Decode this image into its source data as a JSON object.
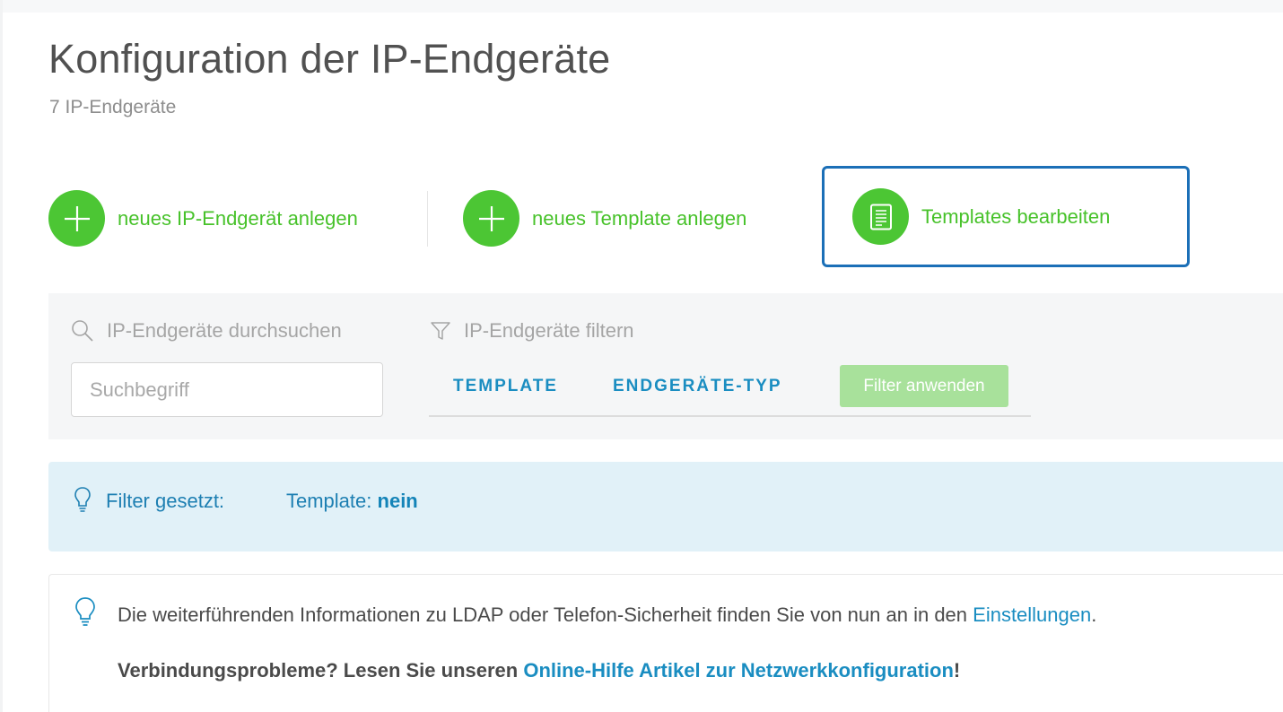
{
  "page": {
    "title": "Konfiguration der IP-Endgeräte",
    "subtitle": "7 IP-Endgeräte"
  },
  "actions": {
    "new_device": {
      "label": "neues IP-Endgerät anlegen",
      "icon": "plus-icon"
    },
    "new_template": {
      "label": "neues Template anlegen",
      "icon": "plus-icon"
    },
    "edit_templates": {
      "label": "Templates bearbeiten",
      "icon": "document-icon"
    }
  },
  "search": {
    "label": "IP-Endgeräte durchsuchen",
    "placeholder": "Suchbegriff",
    "value": "",
    "icon": "search-icon"
  },
  "filter": {
    "label": "IP-Endgeräte filtern",
    "icon": "funnel-icon",
    "tabs": [
      "TEMPLATE",
      "ENDGERÄTE-TYP"
    ],
    "apply_label": "Filter anwenden"
  },
  "active_filter": {
    "label": "Filter gesetzt:",
    "key": "Template:",
    "value": "nein",
    "icon": "lightbulb-icon"
  },
  "info": {
    "icon": "lightbulb-icon",
    "line1_text": "Die weiterführenden Informationen zu LDAP oder Telefon-Sicherheit finden Sie von nun an in den ",
    "line1_link": "Einstellungen",
    "line1_end": ".",
    "line2_text": "Verbindungsprobleme? Lesen Sie unseren ",
    "line2_link": "Online-Hilfe Artikel zur Netzwerkkonfiguration",
    "line2_end": "!"
  },
  "colors": {
    "accent_green": "#4cc634",
    "link_blue": "#1a8dc1",
    "focus_border": "#1b6fb7",
    "banner_bg": "#e1f1f8"
  }
}
